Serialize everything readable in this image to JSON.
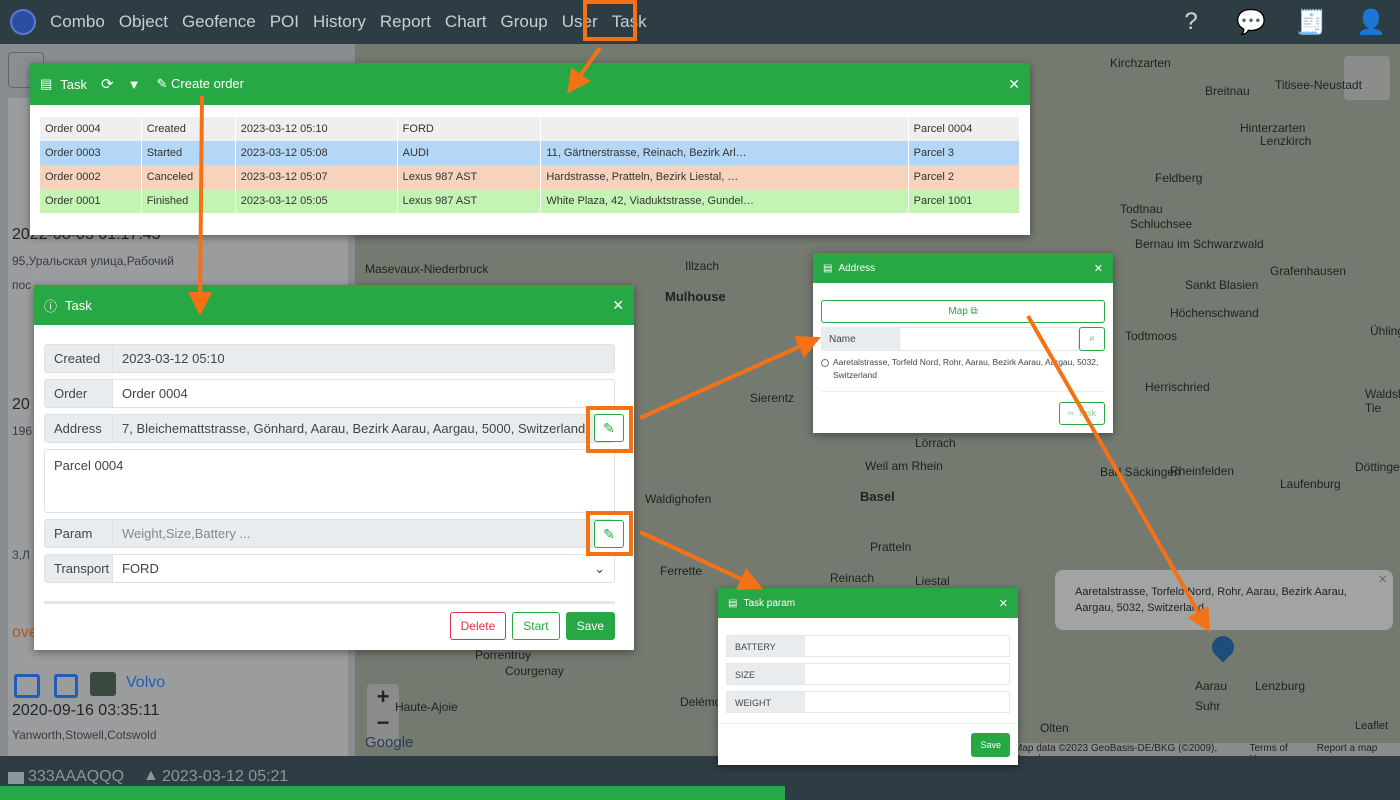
{
  "nav": {
    "items": [
      "Combo",
      "Object",
      "Geofence",
      "POI",
      "History",
      "Report",
      "Chart",
      "Group",
      "User",
      "Task"
    ],
    "right_icons": [
      "help-icon",
      "chat-icon",
      "invoice-icon",
      "user-icon"
    ]
  },
  "map": {
    "labels": [
      "Kirchzarten",
      "Breitnau",
      "Titisee-Neustadt",
      "Hinterzarten",
      "Lenzkirch",
      "Feldberg",
      "Todtnau",
      "Schluchsee",
      "Bernau im Schwarzwald",
      "Grafenhausen",
      "Sankt Blasien",
      "Höchenschwand",
      "Todtmoos",
      "Ühlinger",
      "Herrischried",
      "Waldshut-Tie",
      "Laufenburg",
      "Döttingen",
      "Bad Säckingen",
      "Rheinfelden",
      "Lörrach",
      "Weil am Rhein",
      "Basel",
      "Pratteln",
      "Liestal",
      "Reinach",
      "Mulhouse",
      "Illzach",
      "Masevaux-Niederbruck",
      "Sierentz",
      "Waldighofen",
      "Ferrette",
      "Porrentruy",
      "Courgenay",
      "Haute-Ajoie",
      "Delémont",
      "Olten",
      "Aarau",
      "Suhr",
      "Lenzburg"
    ],
    "attribution": "Map data ©2023 GeoBasis-DE/BKG (©2009), Google",
    "terms": "Terms of Use",
    "report": "Report a map error",
    "leaflet": "Leaflet",
    "zoom_in": "+",
    "zoom_out": "−",
    "google": "Google"
  },
  "sidebar": {
    "date1": "2022-08-03 01:17:43",
    "addr1": "95,Уральская улица,Рабочий",
    "addr1b": "пос",
    "frag": "20",
    "frag2": "196",
    "frag3": "3,Л",
    "over": "ove",
    "vehicle": "Volvo",
    "date2": "2020-09-16 03:35:11",
    "addr2": "Yanworth,Stowell,Cotswold"
  },
  "bottom": {
    "device": "333AAAQQQ",
    "time": "2023-03-12 05:21"
  },
  "task_list": {
    "title": "Task",
    "create": "Create order",
    "rows": [
      {
        "order": "Order 0004",
        "status": "Created",
        "time": "2023-03-12 05:10",
        "vehicle": "FORD",
        "address": "",
        "parcel": "Parcel 0004",
        "color": "#efefef"
      },
      {
        "order": "Order 0003",
        "status": "Started",
        "time": "2023-03-12 05:08",
        "vehicle": "AUDI",
        "address": "11, Gärtnerstrasse, Reinach, Bezirk Arl…",
        "parcel": "Parcel 3",
        "color": "#b3d7f5"
      },
      {
        "order": "Order 0002",
        "status": "Canceled",
        "time": "2023-03-12 05:07",
        "vehicle": "Lexus 987 AST",
        "address": "Hardstrasse, Pratteln, Bezirk Liestal, …",
        "parcel": "Parcel 2",
        "color": "#f7d2bd"
      },
      {
        "order": "Order 0001",
        "status": "Finished",
        "time": "2023-03-12 05:05",
        "vehicle": "Lexus 987 AST",
        "address": "White Plaza, 42, Viaduktstrasse, Gundel…",
        "parcel": "Parcel 1001",
        "color": "#c3f4b4"
      }
    ]
  },
  "task_form": {
    "title": "Task",
    "created_label": "Created",
    "created": "2023-03-12 05:10",
    "order_label": "Order",
    "order": "Order 0004",
    "address_label": "Address",
    "address": "7, Bleichemattstrasse, Gönhard, Aarau, Bezirk Aarau, Aargau, 5000, Switzerland",
    "description": "Parcel 0004",
    "param_label": "Param",
    "param_placeholder": "Weight,Size,Battery ...",
    "transport_label": "Transport",
    "transport": "FORD",
    "delete": "Delete",
    "start": "Start",
    "save": "Save"
  },
  "address_popup": {
    "title": "Address",
    "map_button": "Map",
    "name_label": "Name",
    "name_value": "",
    "result": "Aaretalstrasse, Torfeld Nord, Rohr, Aarau, Bezirk Aarau, Aargau, 5032, Switzerland",
    "task_button": "Task"
  },
  "task_param": {
    "title": "Task param",
    "fields": [
      "BATTERY",
      "SIZE",
      "WEIGHT"
    ],
    "save": "Save"
  },
  "tooltip": {
    "text": "Aaretalstrasse, Torfeld Nord, Rohr, Aarau, Bezirk Aarau, Aargau, 5032, Switzerland",
    "close": "×"
  },
  "colors": {
    "accent": "#28a745",
    "highlight": "#f47216",
    "nav": "#2e3c44"
  }
}
